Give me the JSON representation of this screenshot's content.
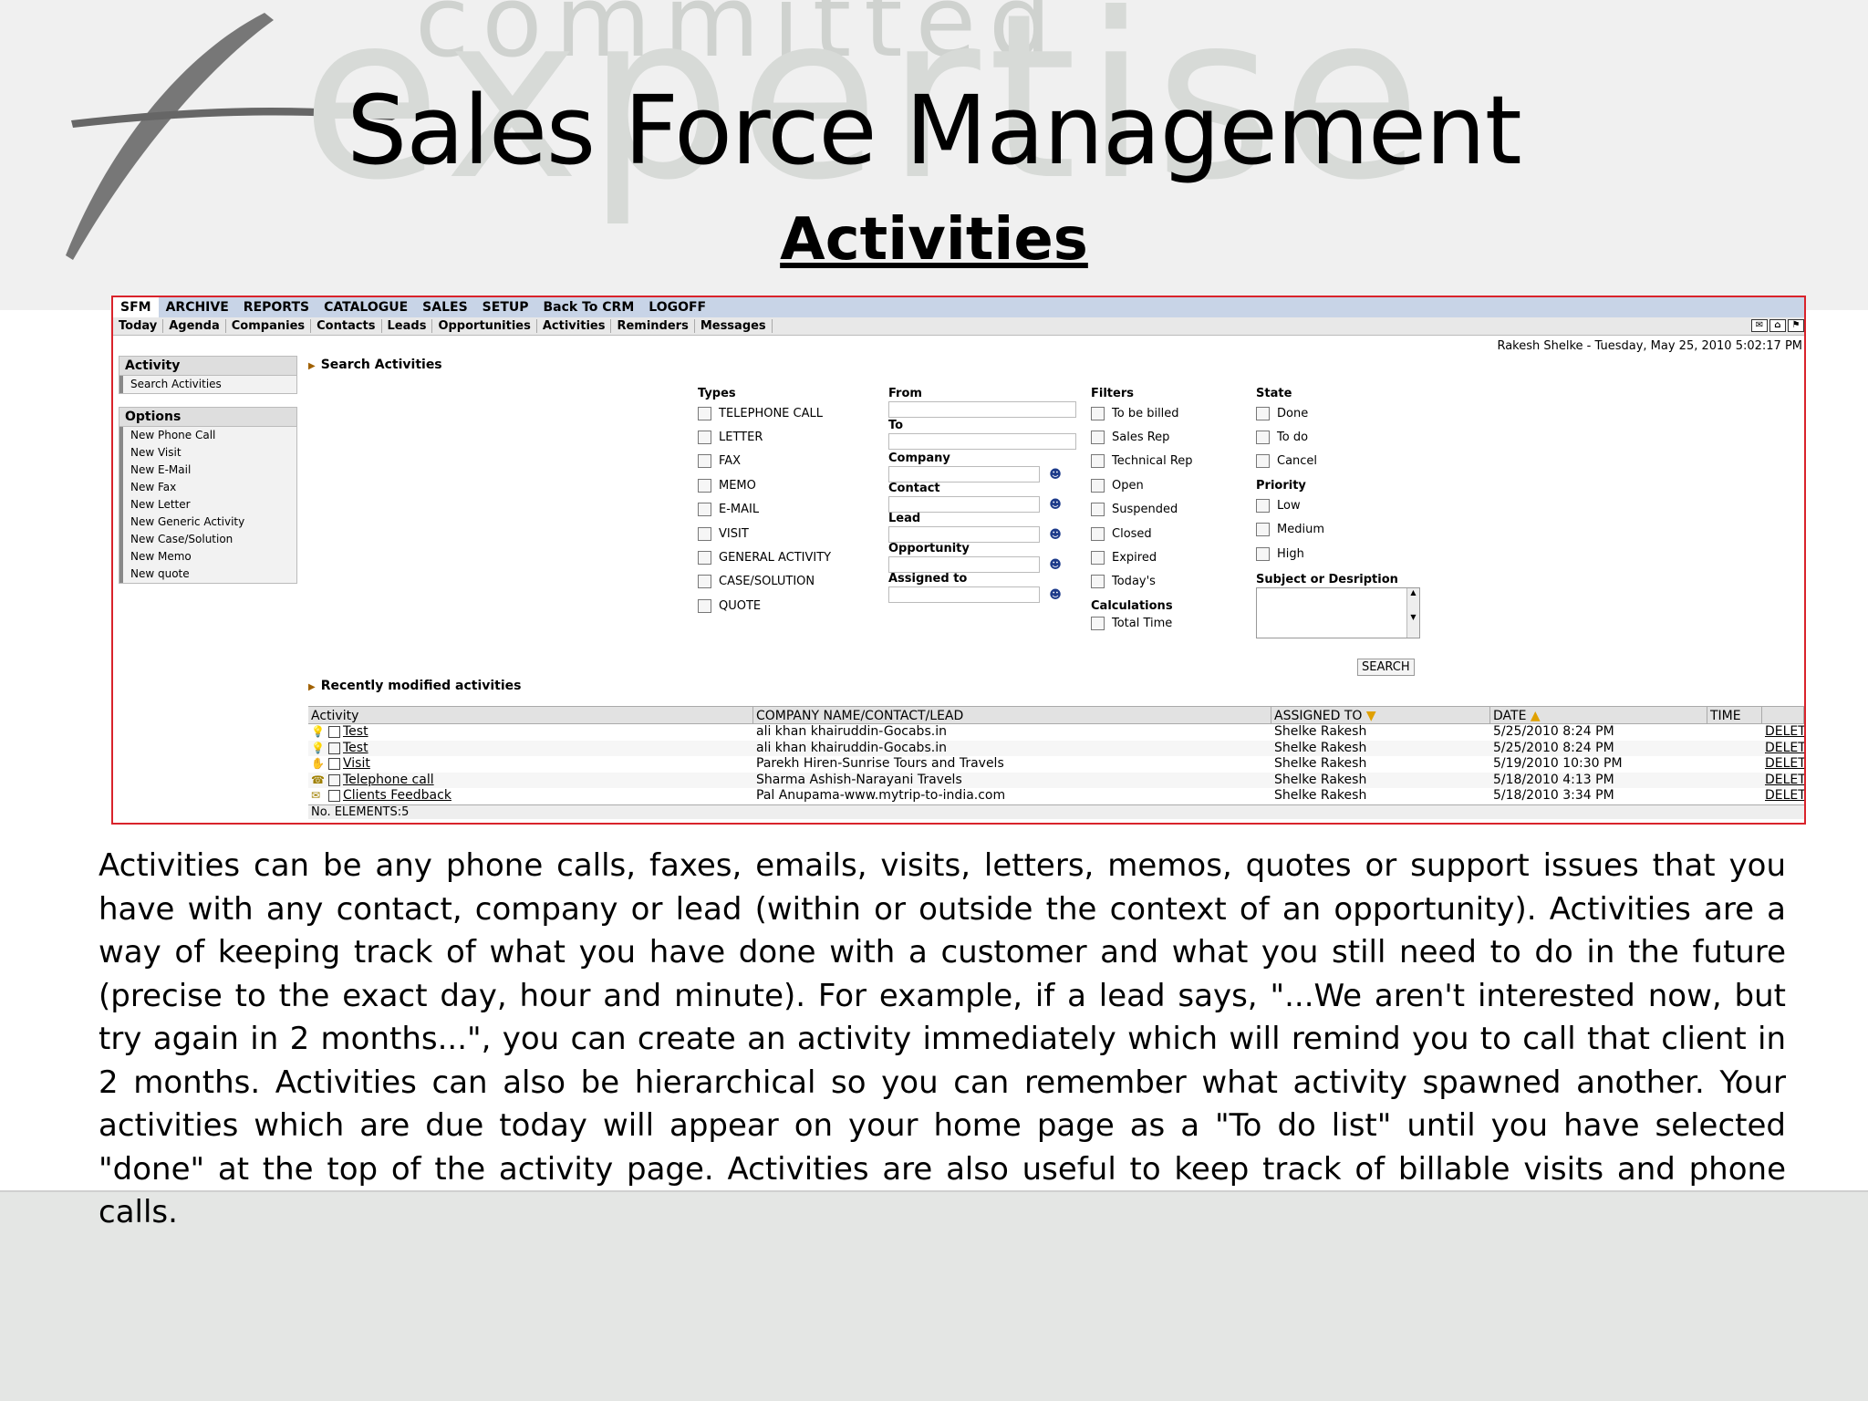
{
  "slide": {
    "watermark_top": "committed",
    "watermark_bottom": "expertise",
    "title": "Sales Force Management",
    "subtitle": "Activities"
  },
  "app": {
    "menu": [
      "SFM",
      "ARCHIVE",
      "REPORTS",
      "CATALOGUE",
      "SALES",
      "SETUP",
      "Back To CRM",
      "LOGOFF"
    ],
    "nav": [
      "Today",
      "Agenda",
      "Companies",
      "Contacts",
      "Leads",
      "Opportunities",
      "Activities",
      "Reminders",
      "Messages"
    ],
    "user_line": "Rakesh Shelke - Tuesday, May 25, 2010 5:02:17 PM",
    "sidebar": {
      "activity_title": "Activity",
      "activity_items": [
        "Search Activities"
      ],
      "options_title": "Options",
      "options_items": [
        "New Phone Call",
        "New Visit",
        "New E-Mail",
        "New Fax",
        "New Letter",
        "New Generic Activity",
        "New Case/Solution",
        "New Memo",
        "New quote"
      ]
    },
    "search": {
      "heading": "Search Activities",
      "types_label": "Types",
      "types": [
        "TELEPHONE CALL",
        "LETTER",
        "FAX",
        "MEMO",
        "E-MAIL",
        "VISIT",
        "GENERAL ACTIVITY",
        "CASE/SOLUTION",
        "QUOTE"
      ],
      "from_label": "From",
      "to_label": "To",
      "company_label": "Company",
      "contact_label": "Contact",
      "lead_label": "Lead",
      "opportunity_label": "Opportunity",
      "assigned_label": "Assigned to",
      "filters_label": "Filters",
      "filters": [
        "To be billed",
        "Sales Rep",
        "Technical Rep",
        "Open",
        "Suspended",
        "Closed",
        "Expired",
        "Today's"
      ],
      "calculations_label": "Calculations",
      "calculations": [
        "Total Time"
      ],
      "state_label": "State",
      "state": [
        "Done",
        "To do",
        "Cancel"
      ],
      "priority_label": "Priority",
      "priority": [
        "Low",
        "Medium",
        "High"
      ],
      "subject_label": "Subject or Desription",
      "search_button": "SEARCH"
    },
    "recent": {
      "heading": "Recently modified activities",
      "columns": [
        "Activity",
        "COMPANY NAME/CONTACT/LEAD",
        "ASSIGNED TO",
        "DATE",
        "TIME",
        ""
      ],
      "rows": [
        {
          "icon": "lightbulb-icon",
          "activity": "Test",
          "company": "ali khan khairuddin-Gocabs.in",
          "assigned": "Shelke Rakesh",
          "date": "5/25/2010 8:24 PM",
          "delete": "DELETE"
        },
        {
          "icon": "lightbulb-icon",
          "activity": "Test",
          "company": "ali khan khairuddin-Gocabs.in",
          "assigned": "Shelke Rakesh",
          "date": "5/25/2010 8:24 PM",
          "delete": "DELETE"
        },
        {
          "icon": "handshake-icon",
          "activity": "Visit",
          "company": "Parekh Hiren-Sunrise Tours and Travels",
          "assigned": "Shelke Rakesh",
          "date": "5/19/2010 10:30 PM",
          "delete": "DELETE"
        },
        {
          "icon": "phone-icon",
          "activity": "Telephone call",
          "company": "Sharma Ashish-Narayani Travels",
          "assigned": "Shelke Rakesh",
          "date": "5/18/2010 4:13 PM",
          "delete": "DELETE"
        },
        {
          "icon": "envelope-icon",
          "activity": "Clients Feedback",
          "company": "Pal Anupama-www.mytrip-to-india.com",
          "assigned": "Shelke Rakesh",
          "date": "5/18/2010 3:34 PM",
          "delete": "DELETE"
        }
      ],
      "footer": "No. ELEMENTS:5"
    }
  },
  "description": "Activities can be any phone calls, faxes, emails, visits, letters, memos, quotes or support issues that you have with any contact, company or lead (within or outside the context of an opportunity). Activities are a way of keeping track of what you have done with a customer and what you still need to do in the future (precise to the exact day, hour and minute). For example, if a lead says, \"...We aren't interested now, but try again in 2 months...\", you can create an activity immediately which will remind you to call that client in 2 months. Activities can also be hierarchical so you can remember what activity spawned another. Your activities which are due today will appear on your home page as a \"To do list\" until you have selected \"done\" at the top of the activity page. Activities are also useful to keep track of billable visits and phone calls."
}
